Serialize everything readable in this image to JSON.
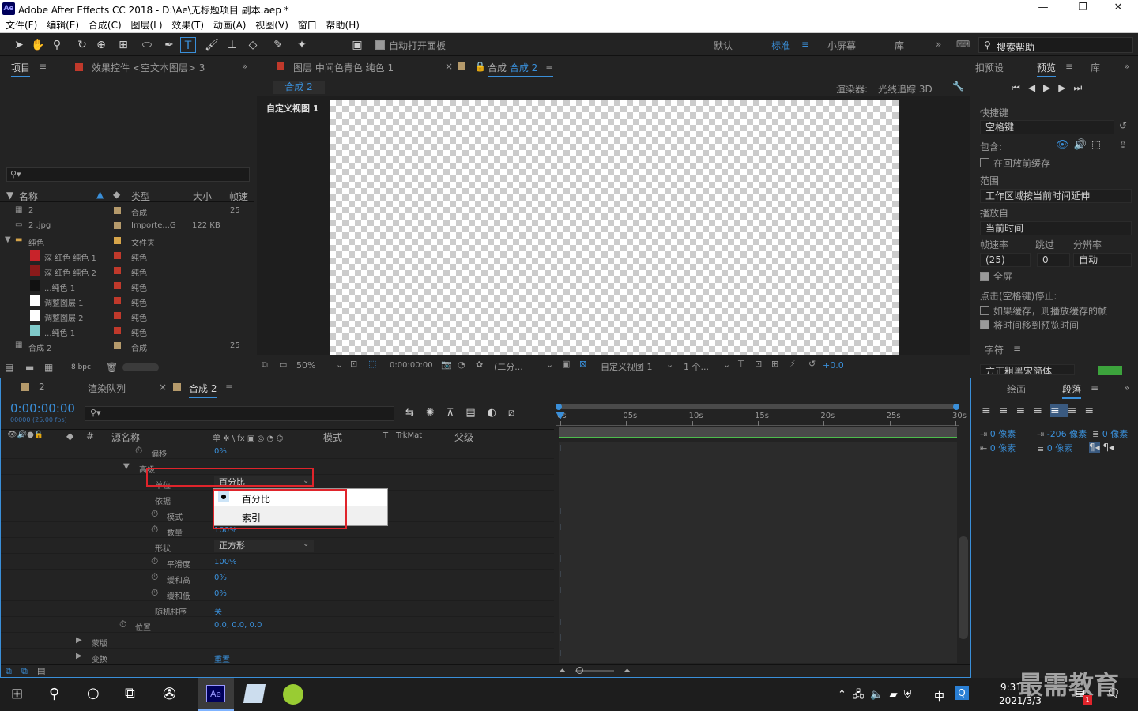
{
  "window": {
    "title": "Adobe After Effects CC 2018 - D:\\Ae\\无标题项目 副本.aep *",
    "app_icon": "Ae"
  },
  "menu": [
    "文件(F)",
    "编辑(E)",
    "合成(C)",
    "图层(L)",
    "效果(T)",
    "动画(A)",
    "视图(V)",
    "窗口",
    "帮助(H)"
  ],
  "toolbar": {
    "auto_open": "自动打开面板",
    "workspaces": [
      "默认",
      "标准",
      "小屏幕",
      "库"
    ],
    "active_ws": "标准",
    "search_help": "搜索帮助"
  },
  "project_panel": {
    "tab_project": "项目",
    "tab_effects": "效果控件 <空文本图层> 3",
    "columns": {
      "name": "名称",
      "type": "类型",
      "size": "大小",
      "fps": "帧速"
    },
    "rows": [
      {
        "name": "2",
        "type": "合成",
        "size": "",
        "fps": "25",
        "color": "#b59a6b",
        "indent": 0,
        "icon": "comp"
      },
      {
        "name": "2 .jpg",
        "type": "Importe...G",
        "size": "122 KB",
        "fps": "",
        "color": "#b59a6b",
        "indent": 0,
        "icon": "file"
      },
      {
        "name": "纯色",
        "type": "文件夹",
        "size": "",
        "fps": "",
        "color": "#d7a54a",
        "indent": 0,
        "icon": "folder"
      },
      {
        "name": "深 红色 纯色 1",
        "type": "纯色",
        "size": "",
        "fps": "",
        "color": "#c0392b",
        "indent": 1,
        "thumb": "#c8232a"
      },
      {
        "name": "深 红色 纯色 2",
        "type": "纯色",
        "size": "",
        "fps": "",
        "color": "#c0392b",
        "indent": 1,
        "thumb": "#8b1a1a"
      },
      {
        "name": "...纯色 1",
        "type": "纯色",
        "size": "",
        "fps": "",
        "color": "#c0392b",
        "indent": 1,
        "thumb": "#111111"
      },
      {
        "name": "调整图层 1",
        "type": "纯色",
        "size": "",
        "fps": "",
        "color": "#c0392b",
        "indent": 1,
        "thumb": "#ffffff"
      },
      {
        "name": "调整图层 2",
        "type": "纯色",
        "size": "",
        "fps": "",
        "color": "#c0392b",
        "indent": 1,
        "thumb": "#ffffff"
      },
      {
        "name": "...纯色 1",
        "type": "纯色",
        "size": "",
        "fps": "",
        "color": "#c0392b",
        "indent": 1,
        "thumb": "#7fc9c9"
      },
      {
        "name": "合成 2",
        "type": "合成",
        "size": "",
        "fps": "25",
        "color": "#b59a6b",
        "indent": 0,
        "icon": "comp"
      }
    ],
    "bpc": "8 bpc"
  },
  "viewer": {
    "tab_layer": "图层 中间色青色 纯色 1",
    "tab_comp_prefix": "合成",
    "tab_comp": "合成 2",
    "breadcrumb": "合成 2",
    "renderer_label": "渲染器:",
    "renderer": "光线追踪 3D",
    "view_label": "自定义视图 1",
    "footer": {
      "zoom": "50%",
      "time": "0:00:00:00",
      "resolution": "(二分...",
      "view": "自定义视图 1",
      "views": "1 个...",
      "exposure": "+0.0"
    }
  },
  "timeline": {
    "tab_2": "2",
    "tab_render": "渲染队列",
    "tab_comp": "合成 2",
    "timecode": "0:00:00:00",
    "timecode_sub": "00000 (25.00 fps)",
    "col_source": "源名称",
    "col_switches": "单 ✲ \\ fx ▣ ◎ ◔ ⌬",
    "col_mode": "模式",
    "col_t": "T",
    "col_trkmat": "TrkMat",
    "col_parent": "父级",
    "ruler": [
      "0s",
      "05s",
      "10s",
      "15s",
      "20s",
      "25s",
      "30s"
    ],
    "rows": [
      {
        "label": "偏移",
        "value": "0%",
        "indent": 190,
        "stopwatch": true
      },
      {
        "label": "高级",
        "value": "",
        "indent": 175,
        "twirl": "open"
      },
      {
        "label": "单位",
        "value": "百分比",
        "indent": 195,
        "dropdown": true,
        "highlight": true
      },
      {
        "label": "依据",
        "value": "",
        "indent": 195
      },
      {
        "label": "模式",
        "value": "",
        "indent": 210,
        "stopwatch": true
      },
      {
        "label": "数量",
        "value": "100%",
        "indent": 210,
        "stopwatch": true
      },
      {
        "label": "形状",
        "value": "正方形",
        "indent": 195,
        "dropdown": true
      },
      {
        "label": "平滑度",
        "value": "100%",
        "indent": 210,
        "stopwatch": true
      },
      {
        "label": "缓和高",
        "value": "0%",
        "indent": 210,
        "stopwatch": true
      },
      {
        "label": "缓和低",
        "value": "0%",
        "indent": 210,
        "stopwatch": true
      },
      {
        "label": "随机排序",
        "value": "关",
        "indent": 195
      },
      {
        "label": "位置",
        "value": "0.0, 0.0, 0.0",
        "indent": 170,
        "stopwatch": true
      },
      {
        "label": "蒙版",
        "value": "",
        "indent": 115,
        "twirl": "closed"
      },
      {
        "label": "变换",
        "value": "重置",
        "indent": 115,
        "twirl": "closed"
      }
    ],
    "popup": {
      "options": [
        "百分比",
        "索引"
      ],
      "selected": "百分比"
    }
  },
  "preview_panel": {
    "tab_presets": "扣预设",
    "tab_preview": "预览",
    "tab_library": "库",
    "shortcut_label": "快捷键",
    "shortcut": "空格键",
    "include_label": "包含:",
    "cache_before": "在回放前缓存",
    "range_label": "范围",
    "range": "工作区域按当前时间延伸",
    "play_from_label": "播放自",
    "play_from": "当前时间",
    "fps_label": "帧速率",
    "skip_label": "跳过",
    "res_label": "分辨率",
    "fps": "(25)",
    "skip": "0",
    "res": "自动",
    "fullscreen": "全屏",
    "stop_label": "点击(空格键)停止:",
    "opt1": "如果缓存，则播放缓存的帧",
    "opt2": "将时间移到预览时间",
    "char_tab": "字符",
    "font": "方正粗黑宋简体"
  },
  "paragraph_panel": {
    "tab_paint": "绘画",
    "tab_paragraph": "段落",
    "indent_left": "0 像素",
    "indent_first": "-206 像素",
    "space_before": "0 像素",
    "indent_right": "0 像素",
    "space_after": "0 像素"
  },
  "taskbar": {
    "time": "9:31",
    "date": "2021/3/3",
    "ime": "中",
    "notif_count": "1",
    "watermark": "最需教育"
  },
  "colors": {
    "accent": "#3a8fd9",
    "highlight_box": "#e0242b",
    "ae_blue": "#00005b"
  }
}
